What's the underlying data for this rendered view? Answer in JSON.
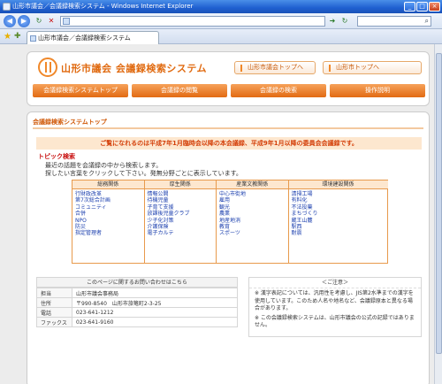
{
  "window": {
    "title": "山形市議会／会議録検索システム - Windows Internet Explorer",
    "controls": {
      "minimize": "_",
      "maximize": "□",
      "close": "×"
    }
  },
  "toolbar": {
    "back_icon": "back-arrow-icon",
    "forward_icon": "forward-arrow-icon",
    "search_placeholder": ""
  },
  "tab": {
    "label": "山形市議会／会議録検索システム"
  },
  "header": {
    "site_title": "山形市議会 会議録検索システム",
    "links": [
      "山形市議会トップへ",
      "山形市トップへ"
    ],
    "nav": [
      "会議録検索システムトップ",
      "会議録の閲覧",
      "会議録の検索",
      "操作説明"
    ]
  },
  "main": {
    "title": "会議録検索システムトップ",
    "notice": "ご覧になれるのは平成7年1月臨時会以降の本会議録、平成9年1月以降の委員会会議録です。",
    "topic_heading": "トピック検索",
    "topic_lines": [
      "最近の話題を会議録の中から検索します。",
      "探したい言葉をクリックして下さい。発無分野ごとに表示しています。"
    ],
    "columns": [
      {
        "heading": "総務関係",
        "items": [
          "行財政改革",
          "第7次総合計画",
          "コミュニティ",
          "合併",
          "NPO",
          "防災",
          "指定管理者"
        ]
      },
      {
        "heading": "厚生関係",
        "items": [
          "情報公開",
          "待機児童",
          "子育て支援",
          "放課後児童クラブ",
          "少子化対策",
          "介護保険",
          "電子カルテ"
        ]
      },
      {
        "heading": "産業文教関係",
        "items": [
          "中心市街地",
          "雇用",
          "観光",
          "農業",
          "地産地消",
          "教育",
          "スポーツ"
        ]
      },
      {
        "heading": "環境建設関係",
        "items": [
          "清掃工場",
          "有料化",
          "不法投棄",
          "まちづくり",
          "蔵王山麓",
          "駅西",
          "耐震"
        ]
      }
    ]
  },
  "contact": {
    "heading": "このページに関するお問い合わせはこちら",
    "rows": [
      {
        "key": "担当",
        "value": "山形市議会事務局"
      },
      {
        "key": "住所",
        "value": "〒990-8540　山形市旅篭町2-3-25"
      },
      {
        "key": "電話",
        "value": "023-641-1212"
      },
      {
        "key": "ファックス",
        "value": "023-641-9160"
      }
    ]
  },
  "note": {
    "heading": "＜ご注意＞",
    "lines": [
      "※ 漢字表記については、汎用性を考慮し、JIS第2水準までの漢字を使用しています。このため人名や地名など、会議録原本と異なる場合があります。",
      "※ この会議録検索システムは、山形市議会の公式の記録ではありません。"
    ]
  },
  "colors": {
    "accent": "#e26a12",
    "notice_bg": "#fde7cf",
    "link": "#1b3fae"
  }
}
